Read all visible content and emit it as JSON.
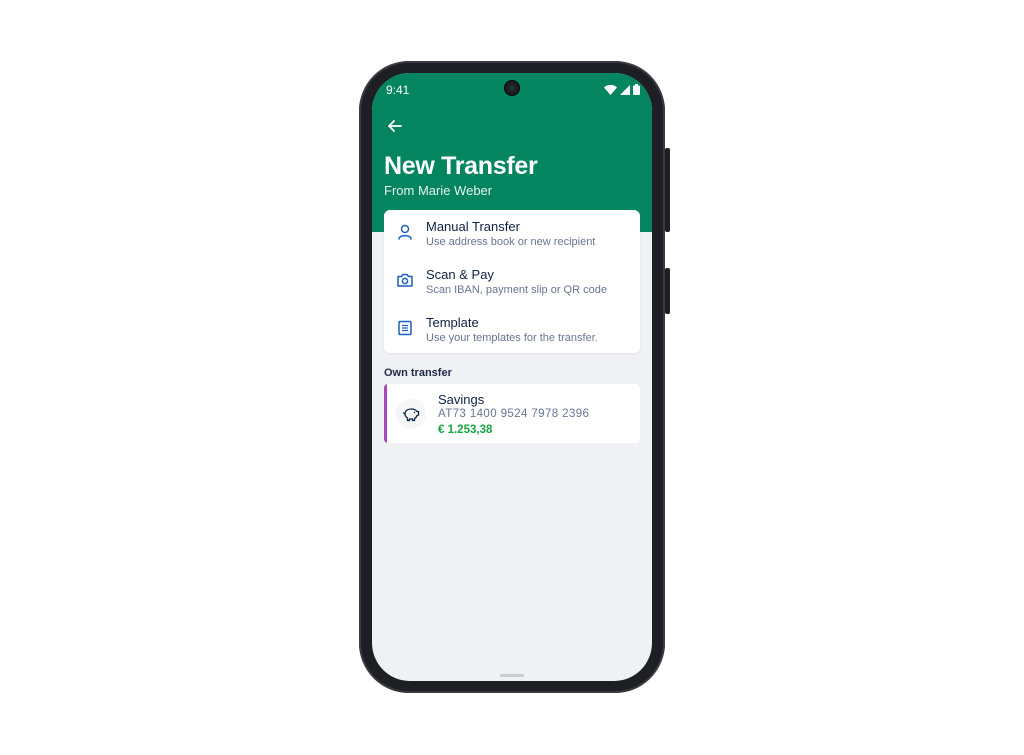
{
  "status_bar": {
    "time": "9:41",
    "icons": [
      "wifi-icon",
      "signal-icon",
      "battery-icon"
    ]
  },
  "header": {
    "back_icon": "arrow-left-icon",
    "title": "New Transfer",
    "subtitle": "From Marie Weber"
  },
  "options": [
    {
      "icon": "person-icon",
      "title": "Manual Transfer",
      "subtitle": "Use address book or new recipient"
    },
    {
      "icon": "camera-icon",
      "title": "Scan & Pay",
      "subtitle": "Scan IBAN, payment slip or QR code"
    },
    {
      "icon": "list-icon",
      "title": "Template",
      "subtitle": "Use your templates for the transfer."
    }
  ],
  "own_transfer": {
    "label": "Own transfer",
    "account": {
      "icon": "piggy-bank-icon",
      "name": "Savings",
      "iban": "AT73 1400 9524 7978 2396",
      "balance": "€ 1.253,38"
    }
  },
  "colors": {
    "brand_green": "#048560",
    "accent_blue": "#1d5fc4",
    "account_accent": "#a548b8",
    "balance_green": "#14a33e"
  }
}
